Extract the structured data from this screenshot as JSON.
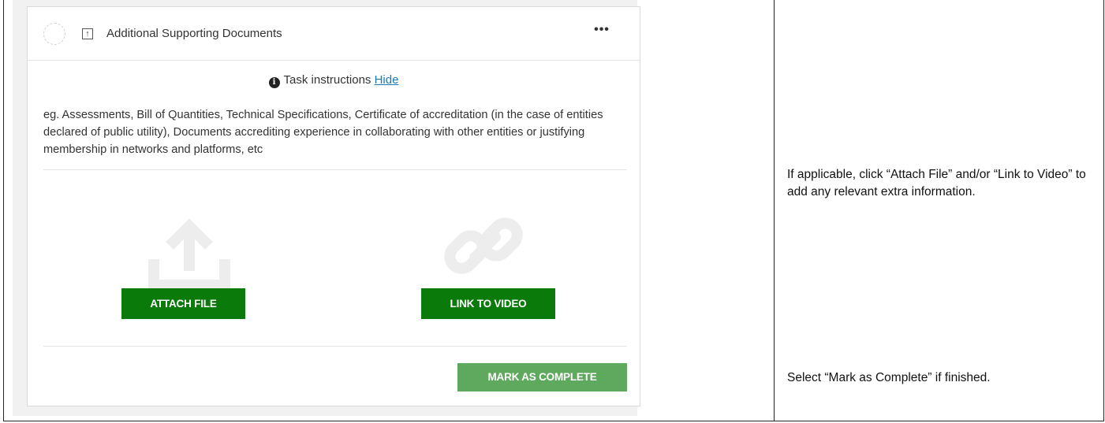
{
  "card": {
    "title": "Additional Supporting Documents",
    "more_label": "•••",
    "instructions_label": "Task instructions",
    "hide_label": "Hide",
    "description": "eg. Assessments, Bill of Quantities, Technical Specifications, Certificate of accreditation (in the case of entities declared of public utility), Documents accrediting experience in collaborating with other entities or justifying membership in networks and platforms, etc",
    "attach_label": "ATTACH FILE",
    "link_video_label": "LINK TO VIDEO",
    "complete_label": "MARK AS COMPLETE"
  },
  "notes": {
    "attach_note": "If applicable, click “Attach File” and/or “Link to Video” to add any relevant extra information.",
    "complete_note": "Select “Mark as Complete” if finished."
  },
  "colors": {
    "primary_green": "#0a7a0a",
    "complete_green": "#5ea95e",
    "link_blue": "#1a7ab8"
  },
  "icons": [
    "status-circle-icon",
    "upload-icon",
    "more-icon",
    "info-icon",
    "upload-large-icon",
    "link-large-icon"
  ]
}
